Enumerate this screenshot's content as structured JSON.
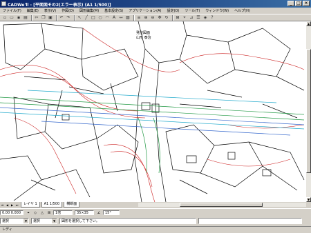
{
  "window": {
    "title": "CADWe'll - [平面図その2(エラー表示) (A1 1/500)]",
    "controls": {
      "minimize": "_",
      "maximize": "□",
      "close": "×"
    }
  },
  "menubar": {
    "items": [
      "ファイル(F)",
      "編集(E)",
      "表示(V)",
      "作図(D)",
      "図形編集(M)",
      "基本設定(S)",
      "アプリケーション(A)",
      "設定(O)",
      "ツール(T)",
      "ウィンドウ(W)",
      "ヘルプ(H)"
    ]
  },
  "toolbar": {
    "icons": [
      "new-icon",
      "open-icon",
      "save-icon",
      "print-icon",
      "cut-icon",
      "copy-icon",
      "paste-icon",
      "undo-icon",
      "redo-icon",
      "pointer-icon",
      "line-icon",
      "rect-icon",
      "circle-icon",
      "arc-icon",
      "text-icon",
      "dimension-icon",
      "hatch-icon",
      "layer-icon",
      "zoom-in-icon",
      "zoom-out-icon",
      "pan-icon",
      "redraw-icon",
      "grid-icon",
      "snap-icon",
      "measure-icon",
      "property-icon",
      "symbol-icon",
      "help-icon"
    ]
  },
  "canvas": {
    "labels": [
      "発注図面",
      "山形 泰治"
    ],
    "colors": {
      "background": "#ffffff",
      "linework": "#000000",
      "contour_red": "#cc2222",
      "contour_green": "#229944",
      "contour_blue": "#3366cc",
      "contour_cyan": "#22aacc"
    }
  },
  "sheetbar": {
    "tabs": [
      "レイヤ 1",
      "A1 1/500",
      "横断面"
    ]
  },
  "options": {
    "coord": "0.00 0.000",
    "scale": "1倍",
    "size": "35×35",
    "angle": "15°"
  },
  "command": {
    "mode": "選択",
    "submode": "選択",
    "prompt": "図形を選択して下さい。"
  },
  "status": {
    "text": "レディ"
  }
}
